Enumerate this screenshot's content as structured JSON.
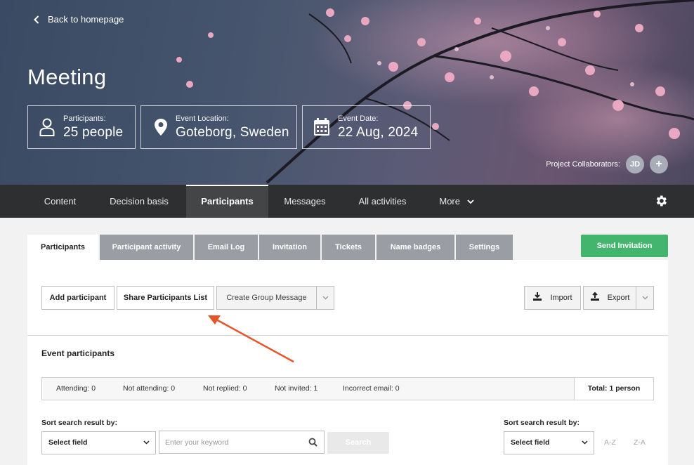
{
  "hero": {
    "back_label": "Back to homepage",
    "title": "Meeting",
    "info": [
      {
        "label": "Participants:",
        "value": "25 people",
        "icon": "person-icon"
      },
      {
        "label": "Event Location:",
        "value": "Goteborg, Sweden",
        "icon": "location-pin-icon"
      },
      {
        "label": "Event Date:",
        "value": "22 Aug, 2024",
        "icon": "calendar-icon"
      }
    ],
    "collaborators_label": "Project Collaborators:",
    "collaborator_initials": "JD",
    "add_collaborator": "+"
  },
  "nav": {
    "items": [
      "Content",
      "Decision basis",
      "Participants",
      "Messages",
      "All activities",
      "More"
    ],
    "active": "Participants"
  },
  "tabs": {
    "items": [
      "Participants",
      "Participant activity",
      "Email Log",
      "Invitation",
      "Tickets",
      "Name badges",
      "Settings"
    ],
    "active": "Participants"
  },
  "send_invitation": "Send Invitation",
  "toolbar": {
    "add_participant": "Add participant",
    "share_list": "Share Participants List",
    "group_message": "Create Group Message",
    "import": "Import",
    "export": "Export"
  },
  "participants": {
    "title": "Event participants",
    "stats": [
      "Attending: 0",
      "Not attending: 0",
      "Not replied: 0",
      "Not invited: 1",
      "Incorrect email: 0"
    ],
    "total": "Total: 1 person"
  },
  "search": {
    "sort_label_left": "Sort search result by:",
    "sort_label_right": "Sort search result by:",
    "select_left": "Select field",
    "select_right": "Select field",
    "keyword_placeholder": "Enter your keyword",
    "search_button": "Search",
    "sort_az": "A-Z",
    "sort_za": "Z-A"
  },
  "colors": {
    "nav_bg": "#2e2f31",
    "tab_inactive": "#9a9da4",
    "send_green": "#43b56d",
    "annotation_arrow": "#e8542a"
  }
}
